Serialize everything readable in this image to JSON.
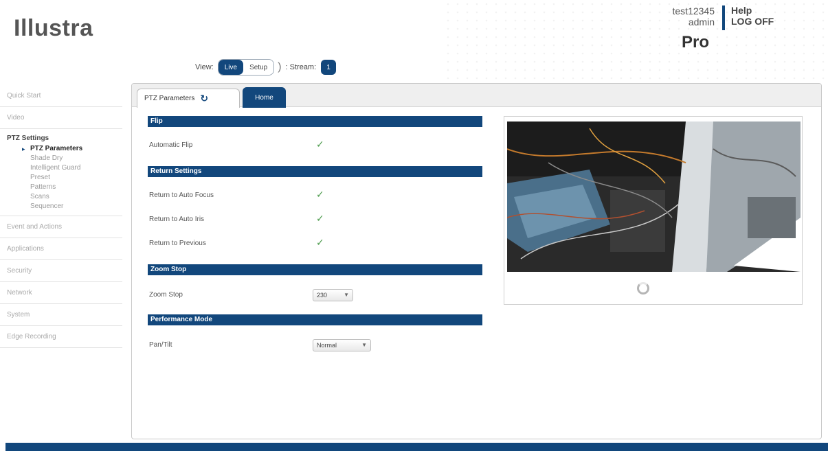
{
  "header": {
    "logo": "Illustra",
    "username": "test12345",
    "role": "admin",
    "help": "Help",
    "logoff": "LOG OFF",
    "edition": "Pro"
  },
  "viewbar": {
    "view_label": "View:",
    "live": "Live",
    "setup": "Setup",
    "paren": ")",
    "stream_label": ": Stream:",
    "stream_value": "1"
  },
  "sidebar": {
    "items_top": [
      "Quick Start",
      "Video"
    ],
    "group_title": "PTZ Settings",
    "subitems": [
      "PTZ Parameters",
      "Shade Dry",
      "Intelligent Guard",
      "Preset",
      "Patterns",
      "Scans",
      "Sequencer"
    ],
    "items_bottom": [
      "Event and Actions",
      "Applications",
      "Security",
      "Network",
      "System",
      "Edge Recording"
    ]
  },
  "tabs": {
    "active": "PTZ Parameters",
    "other": "Home"
  },
  "sections": {
    "flip": {
      "title": "Flip",
      "rows": [
        {
          "label": "Automatic Flip",
          "checked": true
        }
      ]
    },
    "return": {
      "title": "Return Settings",
      "rows": [
        {
          "label": "Return to Auto Focus",
          "checked": true
        },
        {
          "label": "Return to Auto Iris",
          "checked": true
        },
        {
          "label": "Return to Previous",
          "checked": true
        }
      ]
    },
    "zoom": {
      "title": "Zoom Stop",
      "label": "Zoom Stop",
      "value": "230"
    },
    "performance": {
      "title": "Performance Mode",
      "label": "Pan/Tilt",
      "value": "Normal"
    }
  },
  "icons": {
    "check": "check-icon",
    "refresh": "refresh-icon",
    "chevron": "chevron-down-icon",
    "spinner": "loading-spinner-icon"
  },
  "colors": {
    "brand_blue": "#12477c",
    "check_green": "#4a9a4a"
  }
}
